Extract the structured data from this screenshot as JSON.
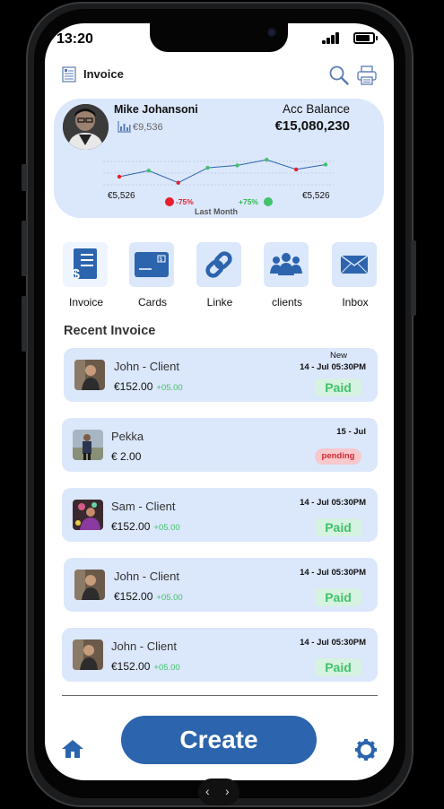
{
  "status": {
    "time": "13:20"
  },
  "header": {
    "title": "Invoice",
    "doc_icon": "invoice-doc-icon",
    "search_icon": "search-icon",
    "print_icon": "printer-icon"
  },
  "account": {
    "name": "Mike Johansoni",
    "small_balance": "€9,536",
    "acc_label": "Acc Balance",
    "acc_value": "€15,080,230",
    "chart_left_value": "€5,526",
    "chart_right_value": "€5,526",
    "negative_change": "-75%",
    "positive_change": "+75%",
    "period_label": "Last Month",
    "colors": {
      "line": "#2c64ad",
      "negative": "#e51f2b",
      "positive": "#41c26b"
    }
  },
  "chart_data": {
    "type": "line",
    "points": [
      {
        "x": 1,
        "y": 0.4,
        "color": "#e51f2b"
      },
      {
        "x": 2,
        "y": 0.55,
        "color": "#41c26b"
      },
      {
        "x": 3,
        "y": 0.25,
        "color": "#e51f2b"
      },
      {
        "x": 4,
        "y": 0.62,
        "color": "#41c26b"
      },
      {
        "x": 5,
        "y": 0.68,
        "color": "#41c26b"
      },
      {
        "x": 6,
        "y": 0.82,
        "color": "#41c26b"
      },
      {
        "x": 7,
        "y": 0.58,
        "color": "#e51f2b"
      },
      {
        "x": 8,
        "y": 0.7,
        "color": "#41c26b"
      }
    ],
    "grid": true
  },
  "quick_actions": [
    {
      "label": "Invoice",
      "icon": "invoice-dollar-icon"
    },
    {
      "label": "Cards",
      "icon": "card-icon"
    },
    {
      "label": "Linke",
      "icon": "link-icon"
    },
    {
      "label": "clients",
      "icon": "clients-group-icon"
    },
    {
      "label": "Inbox",
      "icon": "envelope-icon"
    }
  ],
  "recent": {
    "title": "Recent Invoice",
    "items": [
      {
        "name": "John - Client",
        "amount": "€152.00",
        "change": "+05.00",
        "date": "14 - Jul 05:30PM",
        "tag": "New",
        "status": "Paid"
      },
      {
        "name": "Pekka",
        "amount": "€ 2.00",
        "change": "",
        "date": "15 - Jul",
        "tag": "",
        "status": "pending"
      },
      {
        "name": "Sam - Client",
        "amount": "€152.00",
        "change": "+05.00",
        "date": "14 - Jul 05:30PM",
        "tag": "",
        "status": "Paid"
      },
      {
        "name": "John - Client",
        "amount": "€152.00",
        "change": "+05.00",
        "date": "14 - Jul 05:30PM",
        "tag": "",
        "status": "Paid"
      },
      {
        "name": "John - Client",
        "amount": "€152.00",
        "change": "+05.00",
        "date": "14 - Jul 05:30PM",
        "tag": "",
        "status": "Paid"
      }
    ]
  },
  "bottom": {
    "create_label": "Create",
    "home_icon": "home-icon",
    "settings_icon": "gear-icon"
  },
  "nav": {
    "back": "‹",
    "forward": "›"
  }
}
